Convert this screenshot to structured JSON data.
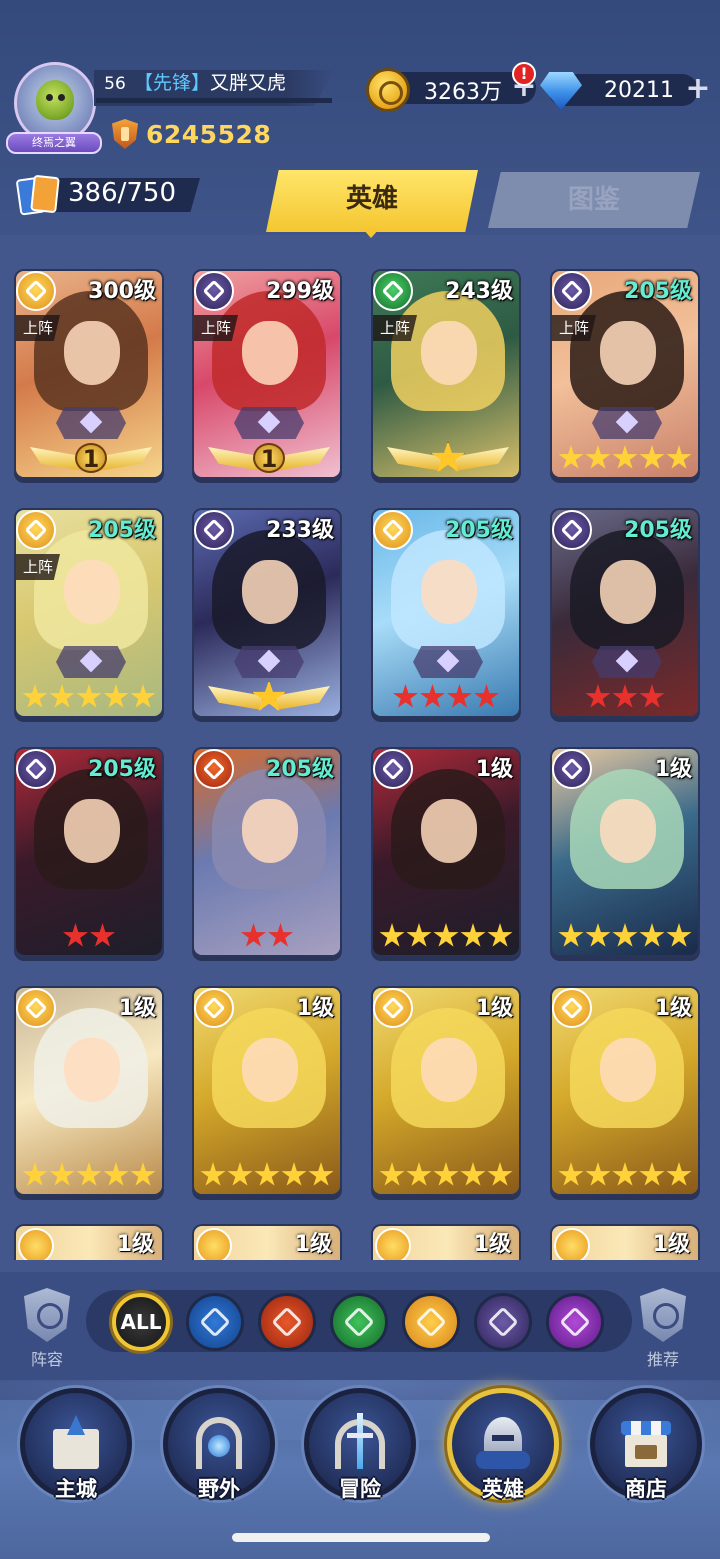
{
  "player": {
    "level": "56",
    "title_tag": "【先锋】",
    "name": "又胖又虎",
    "avatar_plaque": "终焉之翼",
    "power": "6245528"
  },
  "resources": {
    "gold": "3263万",
    "diamonds": "20211",
    "gold_alert": "!"
  },
  "hero_count": "386/750",
  "tabs": [
    {
      "label": "英雄",
      "active": true
    },
    {
      "label": "图鉴",
      "active": false
    }
  ],
  "cards": [
    {
      "level": "300级",
      "element": "light",
      "deployed": "上阵",
      "rank": "1",
      "display": "wings-rank"
    },
    {
      "level": "299级",
      "element": "dark",
      "deployed": "上阵",
      "rank": "1",
      "display": "wings-rank"
    },
    {
      "level": "243级",
      "element": "wind",
      "deployed": "上阵",
      "display": "wings-star"
    },
    {
      "level": "205级",
      "element": "dark",
      "deployed": "上阵",
      "stars": 5,
      "star_color": "gold"
    },
    {
      "level": "205级",
      "element": "light",
      "deployed": "上阵",
      "stars": 5,
      "star_color": "gold"
    },
    {
      "level": "233级",
      "element": "dark",
      "display": "wings-star"
    },
    {
      "level": "205级",
      "element": "light",
      "stars": 4,
      "star_color": "red"
    },
    {
      "level": "205级",
      "element": "dark",
      "stars": 3,
      "star_color": "red"
    },
    {
      "level": "205级",
      "element": "dark",
      "stars": 2,
      "star_color": "red"
    },
    {
      "level": "205级",
      "element": "fire",
      "stars": 2,
      "star_color": "red"
    },
    {
      "level": "1级",
      "element": "dark",
      "stars": 5,
      "star_color": "gold"
    },
    {
      "level": "1级",
      "element": "dark",
      "stars": 5,
      "star_color": "gold"
    },
    {
      "level": "1级",
      "element": "light",
      "stars": 5,
      "star_color": "gold"
    },
    {
      "level": "1级",
      "element": "light",
      "stars": 5,
      "star_color": "gold"
    },
    {
      "level": "1级",
      "element": "light",
      "stars": 5,
      "star_color": "gold"
    },
    {
      "level": "1级",
      "element": "light",
      "stars": 5,
      "star_color": "gold"
    }
  ],
  "partial_cards": [
    "1级",
    "1级",
    "1级",
    "1级"
  ],
  "filters": {
    "all_label": "ALL",
    "elements": [
      "water",
      "fire",
      "wind",
      "light",
      "dark",
      "void"
    ],
    "lineup_label": "阵容",
    "recommend_label": "推荐"
  },
  "bottom_nav": [
    "主城",
    "野外",
    "冒险",
    "英雄",
    "商店"
  ],
  "colors": {
    "accent_tab": "#f5c631",
    "level_teal": "#63ecd2",
    "star_gold": "#ffd23a",
    "star_red": "#e8302c"
  }
}
